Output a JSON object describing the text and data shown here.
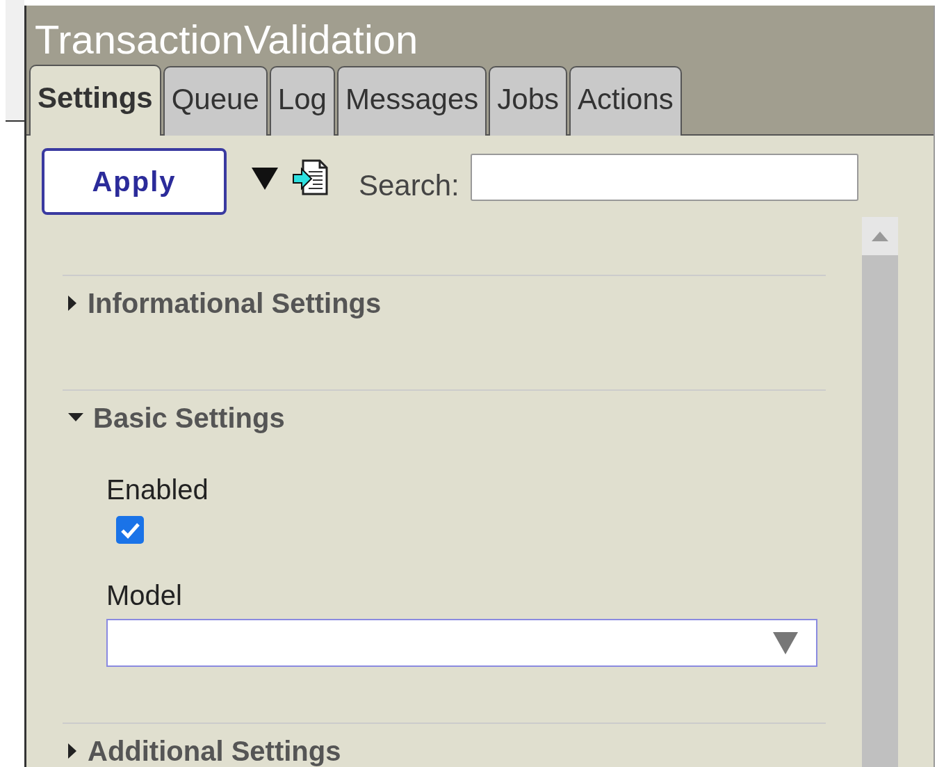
{
  "window": {
    "title": "TransactionValidation"
  },
  "tabs": [
    {
      "label": "Settings",
      "selected": true
    },
    {
      "label": "Queue",
      "selected": false
    },
    {
      "label": "Log",
      "selected": false
    },
    {
      "label": "Messages",
      "selected": false
    },
    {
      "label": "Jobs",
      "selected": false
    },
    {
      "label": "Actions",
      "selected": false
    }
  ],
  "toolbar": {
    "apply_button": "Apply",
    "search": {
      "label": "Search:"
    }
  },
  "sections": [
    {
      "title": "Informational Settings",
      "expanded": false
    },
    {
      "title": "Basic Settings",
      "expanded": true,
      "fields": [
        {
          "kind": "checkbox",
          "label": "Enabled",
          "checked": true
        },
        {
          "kind": "select",
          "label": "Model"
        }
      ]
    },
    {
      "title": "Additional Settings",
      "expanded": false
    }
  ]
}
